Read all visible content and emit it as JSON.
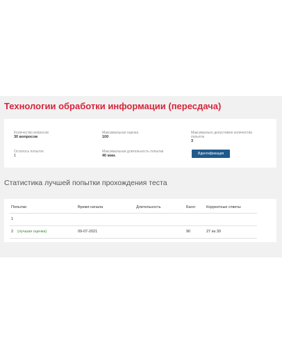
{
  "title": "Технологии обработки информации (пересдача)",
  "info": {
    "questions_label": "Количество вопросов",
    "questions_value": "30 вопросов",
    "max_score_label": "Максимальная оценка",
    "max_score_value": "100",
    "max_attempts_label": "Максимально допустимое количество попыток",
    "max_attempts_value": "3",
    "attempts_left_label": "Осталось попыток",
    "attempts_left_value": "1",
    "max_duration_label": "Максимальная длительность попытки",
    "max_duration_value": "40 мин.",
    "identify_button": "Идентификация"
  },
  "stats_title": "Статистика лучшей попытки прохождения теста",
  "table": {
    "headers": [
      "Попытки",
      "Время начала",
      "Длительность",
      "Балл",
      "Корректные ответы"
    ],
    "rows": [
      {
        "attempt": "1",
        "note": "",
        "start": "",
        "duration": "",
        "score": "",
        "correct": ""
      },
      {
        "attempt": "2",
        "note": "(лучшая оценка)",
        "start": "09-07-2021",
        "duration": "",
        "score": "90",
        "correct": "27 из 30"
      }
    ]
  }
}
